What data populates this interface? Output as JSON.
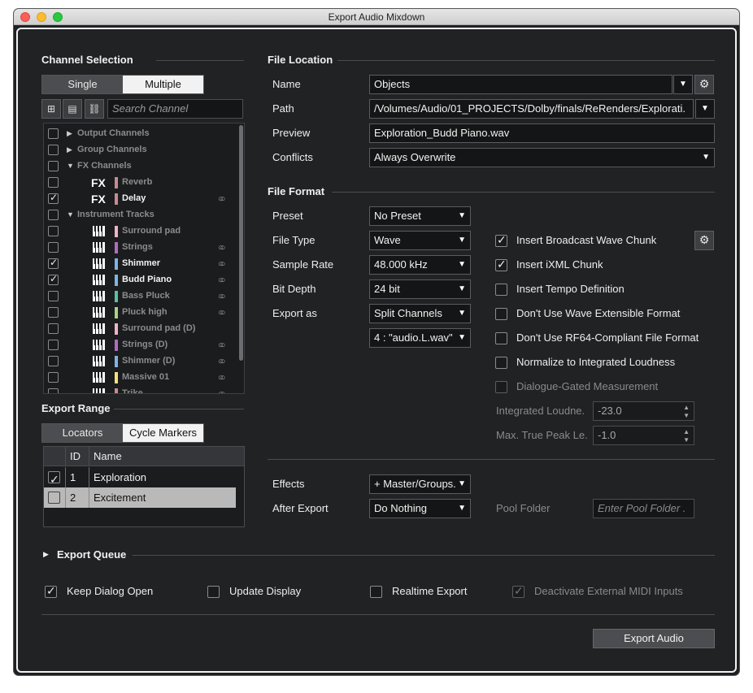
{
  "window": {
    "title": "Export Audio Mixdown"
  },
  "channel_selection": {
    "title": "Channel Selection",
    "modes": [
      "Single",
      "Multiple"
    ],
    "search_placeholder": "Search Channel",
    "tree": [
      {
        "type": "folder",
        "label": "Output Channels",
        "expanded": false,
        "checked": false
      },
      {
        "type": "folder",
        "label": "Group Channels",
        "expanded": false,
        "checked": false
      },
      {
        "type": "folder",
        "label": "FX Channels",
        "expanded": true,
        "checked": false
      },
      {
        "type": "fx",
        "label": "Reverb",
        "checked": false,
        "color": "#c98a94",
        "link": false,
        "bright": false
      },
      {
        "type": "fx",
        "label": "Delay",
        "checked": true,
        "color": "#c98a94",
        "link": true,
        "bright": true
      },
      {
        "type": "folder",
        "label": "Instrument Tracks",
        "expanded": true,
        "checked": false
      },
      {
        "type": "inst",
        "label": "Surround pad",
        "checked": false,
        "color": "#f0b2c8",
        "link": false,
        "bright": false
      },
      {
        "type": "inst",
        "label": "Strings",
        "checked": false,
        "color": "#b06bc0",
        "link": true,
        "bright": false
      },
      {
        "type": "inst",
        "label": "Shimmer",
        "checked": true,
        "color": "#7fb3e6",
        "link": true,
        "bright": true
      },
      {
        "type": "inst",
        "label": "Budd Piano",
        "checked": true,
        "color": "#7fb3e6",
        "link": true,
        "bright": true
      },
      {
        "type": "inst",
        "label": "Bass Pluck",
        "checked": false,
        "color": "#5bbfa8",
        "link": true,
        "bright": false
      },
      {
        "type": "inst",
        "label": "Pluck high",
        "checked": false,
        "color": "#a6d486",
        "link": true,
        "bright": false
      },
      {
        "type": "inst",
        "label": "Surround pad (D)",
        "checked": false,
        "color": "#f0b2c8",
        "link": false,
        "bright": false
      },
      {
        "type": "inst",
        "label": "Strings (D)",
        "checked": false,
        "color": "#b06bc0",
        "link": true,
        "bright": false
      },
      {
        "type": "inst",
        "label": "Shimmer (D)",
        "checked": false,
        "color": "#7fb3e6",
        "link": true,
        "bright": false
      },
      {
        "type": "inst",
        "label": "Massive 01",
        "checked": false,
        "color": "#f5e07a",
        "link": true,
        "bright": false
      },
      {
        "type": "inst",
        "label": "Trike",
        "checked": false,
        "color": "#c98a94",
        "link": true,
        "bright": false
      }
    ]
  },
  "export_range": {
    "title": "Export Range",
    "modes": [
      "Locators",
      "Cycle Markers"
    ],
    "columns": [
      "ID",
      "Name"
    ],
    "rows": [
      {
        "id": "1",
        "name": "Exploration",
        "checked": true
      },
      {
        "id": "2",
        "name": "Excitement",
        "checked": false
      }
    ]
  },
  "file_location": {
    "title": "File Location",
    "name_label": "Name",
    "name_value": "Objects",
    "path_label": "Path",
    "path_value": "/Volumes/Audio/01_PROJECTS/Dolby/finals/ReRenders/Explorati.",
    "preview_label": "Preview",
    "preview_value": "Exploration_Budd Piano.wav",
    "conflicts_label": "Conflicts",
    "conflicts_value": "Always Overwrite"
  },
  "file_format": {
    "title": "File Format",
    "preset_label": "Preset",
    "preset_value": "No Preset",
    "file_type_label": "File Type",
    "file_type_value": "Wave",
    "sample_rate_label": "Sample Rate",
    "sample_rate_value": "48.000 kHz",
    "bit_depth_label": "Bit Depth",
    "bit_depth_value": "24 bit",
    "export_as_label": "Export as",
    "export_as_value": "Split Channels",
    "naming_value": "4 : \"audio.L.wav\"",
    "options": [
      {
        "label": "Insert Broadcast Wave Chunk",
        "checked": true,
        "disabled": false
      },
      {
        "label": "Insert iXML Chunk",
        "checked": true,
        "disabled": false
      },
      {
        "label": "Insert Tempo Definition",
        "checked": false,
        "disabled": false
      },
      {
        "label": "Don't Use Wave Extensible Format",
        "checked": false,
        "disabled": false
      },
      {
        "label": "Don't Use RF64-Compliant File Format",
        "checked": false,
        "disabled": false
      },
      {
        "label": "Normalize to Integrated Loudness",
        "checked": false,
        "disabled": false
      },
      {
        "label": "Dialogue-Gated Measurement",
        "checked": false,
        "disabled": true
      }
    ],
    "integrated_label": "Integrated Loudne.",
    "integrated_value": "-23.0",
    "true_peak_label": "Max. True Peak Le.",
    "true_peak_value": "-1.0"
  },
  "post": {
    "effects_label": "Effects",
    "effects_value": "+ Master/Groups.",
    "after_export_label": "After Export",
    "after_export_value": "Do Nothing",
    "pool_folder_label": "Pool Folder",
    "pool_folder_placeholder": "Enter Pool Folder ."
  },
  "export_queue": {
    "title": "Export Queue"
  },
  "bottom": {
    "keep_dialog_open": {
      "label": "Keep Dialog Open",
      "checked": true
    },
    "update_display": {
      "label": "Update Display",
      "checked": false
    },
    "realtime_export": {
      "label": "Realtime Export",
      "checked": false
    },
    "deactivate_midi": {
      "label": "Deactivate External MIDI Inputs",
      "checked": true
    },
    "export_button": "Export Audio"
  }
}
